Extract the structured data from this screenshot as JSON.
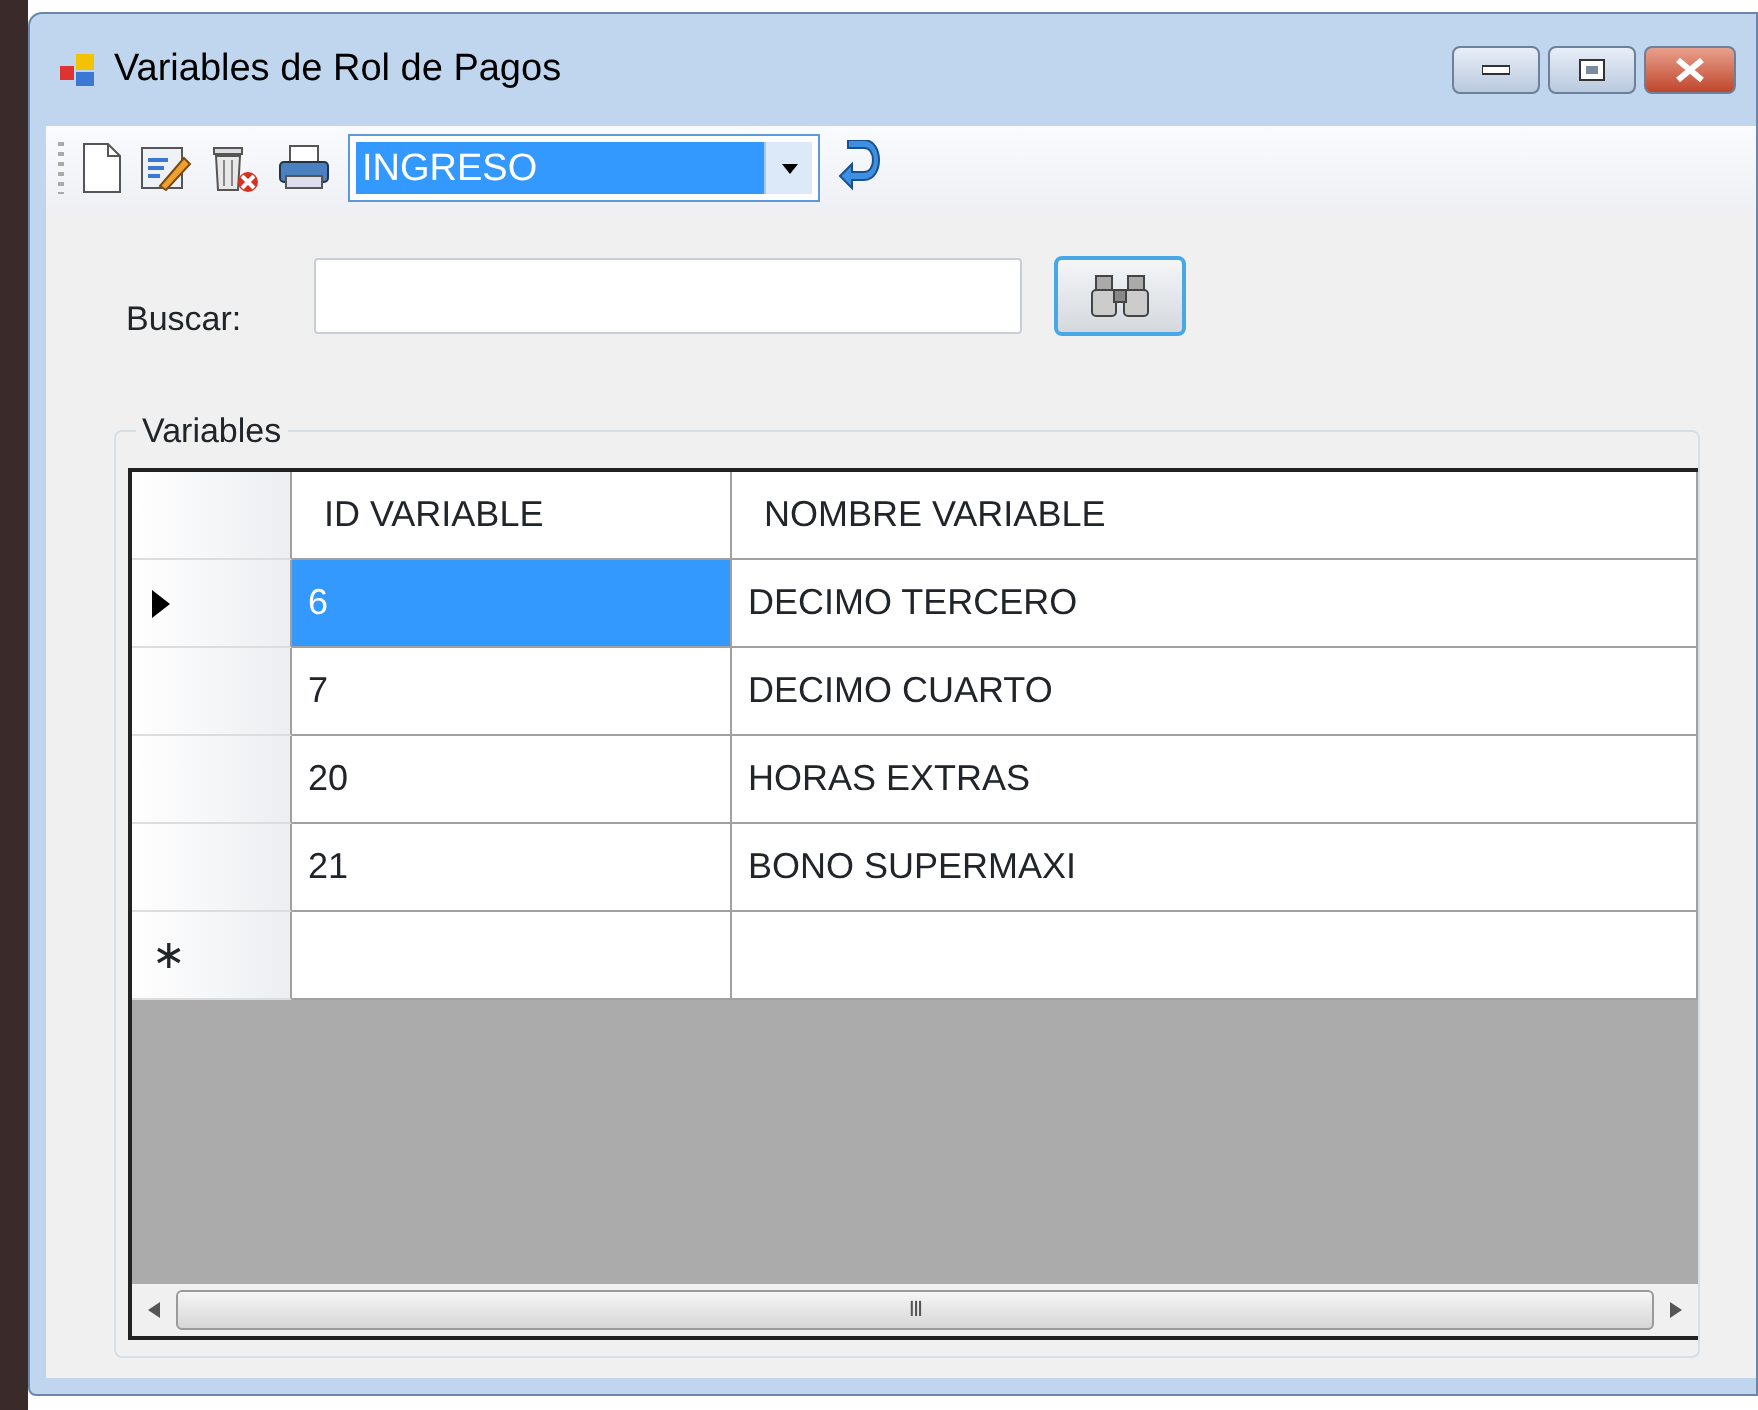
{
  "window": {
    "title": "Variables de Rol de Pagos"
  },
  "toolbar": {
    "combo": {
      "value": "INGRESO",
      "highlighted": true
    }
  },
  "search": {
    "label": "Buscar:"
  },
  "group": {
    "title": "Variables"
  },
  "table": {
    "columns": [
      "ID VARIABLE",
      "NOMBRE VARIABLE"
    ],
    "rows": [
      {
        "cells": [
          "6",
          "DECIMO TERCERO"
        ],
        "selected": true
      },
      {
        "cells": [
          "7",
          "DECIMO CUARTO"
        ],
        "selected": false
      },
      {
        "cells": [
          "20",
          "HORAS EXTRAS"
        ],
        "selected": false
      },
      {
        "cells": [
          "21",
          "BONO SUPERMAXI"
        ],
        "selected": false
      }
    ],
    "new_row_marker": "∗"
  },
  "scrollbar": {
    "grip": "III"
  }
}
